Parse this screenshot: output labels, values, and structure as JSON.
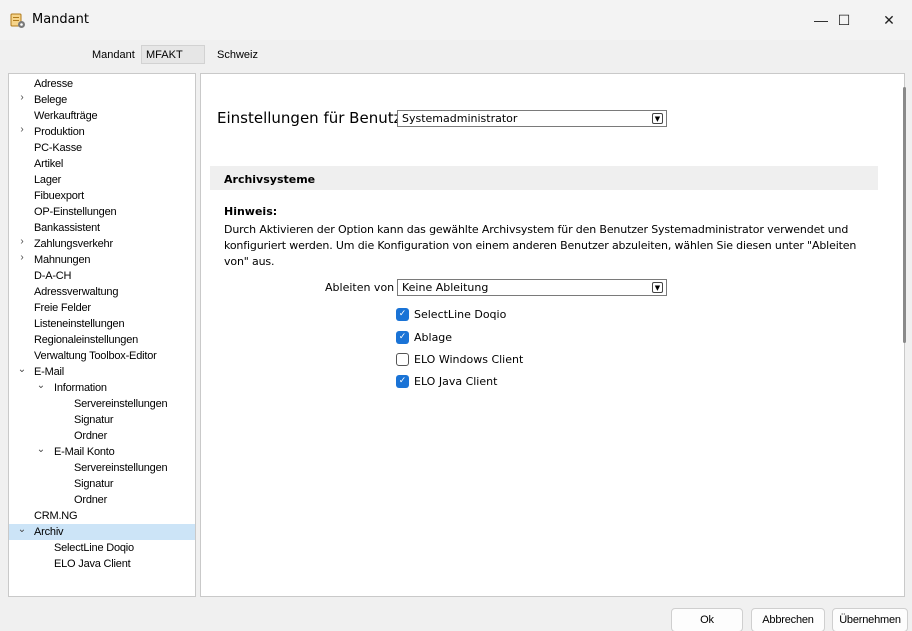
{
  "window": {
    "title": "Mandant",
    "minimize": "—",
    "maximize": "☐",
    "close": "✕"
  },
  "mandant": {
    "label": "Mandant",
    "code": "MFAKT",
    "name": "Schweiz"
  },
  "tree": {
    "items": [
      {
        "label": "Adresse"
      },
      {
        "label": "Belege",
        "chevron": "›"
      },
      {
        "label": "Werkaufträge"
      },
      {
        "label": "Produktion",
        "chevron": "›"
      },
      {
        "label": "PC-Kasse"
      },
      {
        "label": "Artikel"
      },
      {
        "label": "Lager"
      },
      {
        "label": "Fibuexport"
      },
      {
        "label": "OP-Einstellungen"
      },
      {
        "label": "Bankassistent"
      },
      {
        "label": "Zahlungsverkehr",
        "chevron": "›"
      },
      {
        "label": "Mahnungen",
        "chevron": "›"
      },
      {
        "label": "D-A-CH"
      },
      {
        "label": "Adressverwaltung"
      },
      {
        "label": "Freie Felder"
      },
      {
        "label": "Listeneinstellungen"
      },
      {
        "label": "Regionaleinstellungen"
      },
      {
        "label": "Verwaltung Toolbox-Editor"
      },
      {
        "label": "E-Mail",
        "chevron": "⌄"
      },
      {
        "label": "Information",
        "chevron": "⌄"
      },
      {
        "label": "Servereinstellungen"
      },
      {
        "label": "Signatur"
      },
      {
        "label": "Ordner"
      },
      {
        "label": "E-Mail Konto",
        "chevron": "⌄"
      },
      {
        "label": "Servereinstellungen"
      },
      {
        "label": "Signatur"
      },
      {
        "label": "Ordner"
      },
      {
        "label": "CRM.NG"
      },
      {
        "label": "Archiv",
        "chevron": "⌄"
      },
      {
        "label": "SelectLine Doqio"
      },
      {
        "label": "ELO Java Client"
      }
    ]
  },
  "settings": {
    "label": "Einstellungen für Benutzer",
    "user": "Systemadministrator"
  },
  "section": {
    "title": "Archivsysteme",
    "hint_title": "Hinweis:",
    "hint_text": "Durch Aktivieren der Option kann das gewählte Archivsystem für den Benutzer Systemadministrator verwendet und konfiguriert werden. Um die Konfiguration von einem anderen Benutzer abzuleiten, wählen Sie diesen unter \"Ableiten von\" aus.",
    "derive_label": "Ableiten von",
    "derive_value": "Keine Ableitung"
  },
  "checkboxes": [
    {
      "label": "SelectLine Doqio",
      "checked": true
    },
    {
      "label": "Ablage",
      "checked": true
    },
    {
      "label": "ELO Windows Client",
      "checked": false
    },
    {
      "label": "ELO Java Client",
      "checked": true
    }
  ],
  "buttons": {
    "ok": "Ok",
    "cancel": "Abbrechen",
    "apply": "Übernehmen"
  },
  "colors": {
    "accent": "#1a73d6",
    "selection": "#cce4f7"
  }
}
